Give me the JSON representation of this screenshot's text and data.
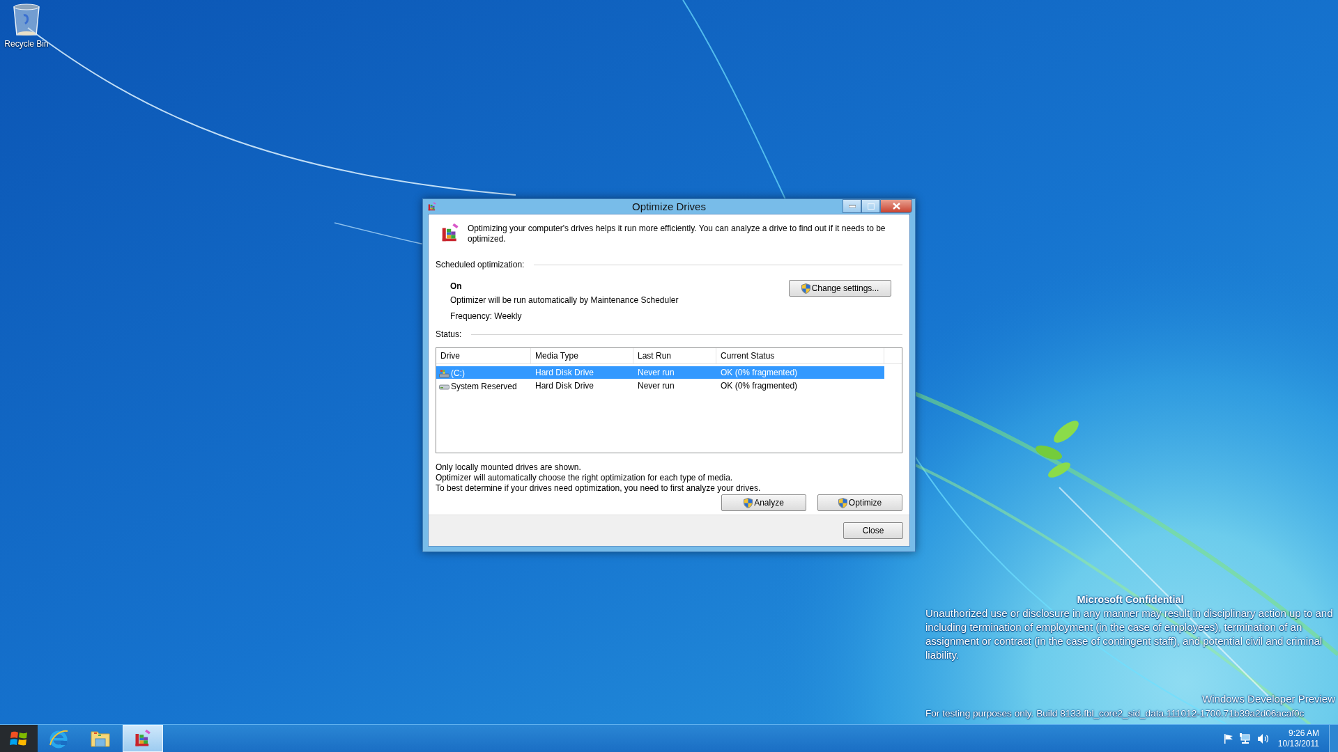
{
  "desktop": {
    "icons": [
      {
        "label": "Recycle Bin"
      }
    ],
    "notice": {
      "title": "Microsoft Confidential",
      "text": "Unauthorized use or disclosure in any manner may result in disciplinary action up to and including termination of employment (in the case of employees), termination of an assignment or contract (in the case of contingent staff), and potential civil and criminal liability.",
      "edition": "Windows Developer Preview",
      "build": "For testing purposes only. Build 8133.fbl_core2_sid_data.111012-1700.71b39a2d06acaf0c"
    }
  },
  "window": {
    "title": "Optimize Drives",
    "intro": "Optimizing your computer's drives helps it run more efficiently. You can analyze a drive to find out if it needs to be optimized.",
    "scheduled": {
      "heading": "Scheduled optimization:",
      "state": "On",
      "description": "Optimizer will be run automatically by Maintenance Scheduler",
      "frequency": "Frequency: Weekly",
      "button": "Change settings..."
    },
    "status": {
      "heading": "Status:",
      "columns": [
        "Drive",
        "Media Type",
        "Last Run",
        "Current Status"
      ],
      "rows": [
        {
          "kind": "system",
          "drive": "(C:)",
          "media_type": "Hard Disk Drive",
          "last_run": "Never run",
          "current_status": "OK (0% fragmented)",
          "selected": true
        },
        {
          "kind": "plain",
          "drive": "System Reserved",
          "media_type": "Hard Disk Drive",
          "last_run": "Never run",
          "current_status": "OK (0% fragmented)",
          "selected": false
        }
      ]
    },
    "notes": [
      "Only locally mounted drives are shown.",
      "Optimizer will automatically choose the right optimization for each type of media.",
      "To best determine if your drives need optimization, you need to first analyze your drives."
    ],
    "buttons": [
      "Analyze",
      "Optimize"
    ],
    "close_button": "Close"
  },
  "taskbar": {
    "items": [
      {
        "kind": "start",
        "selected": false
      },
      {
        "kind": "browser",
        "selected": false
      },
      {
        "kind": "folder",
        "selected": false
      },
      {
        "kind": "optimizer",
        "selected": true
      }
    ],
    "clock": {
      "time": "9:26 AM",
      "date": "10/13/2011"
    }
  }
}
